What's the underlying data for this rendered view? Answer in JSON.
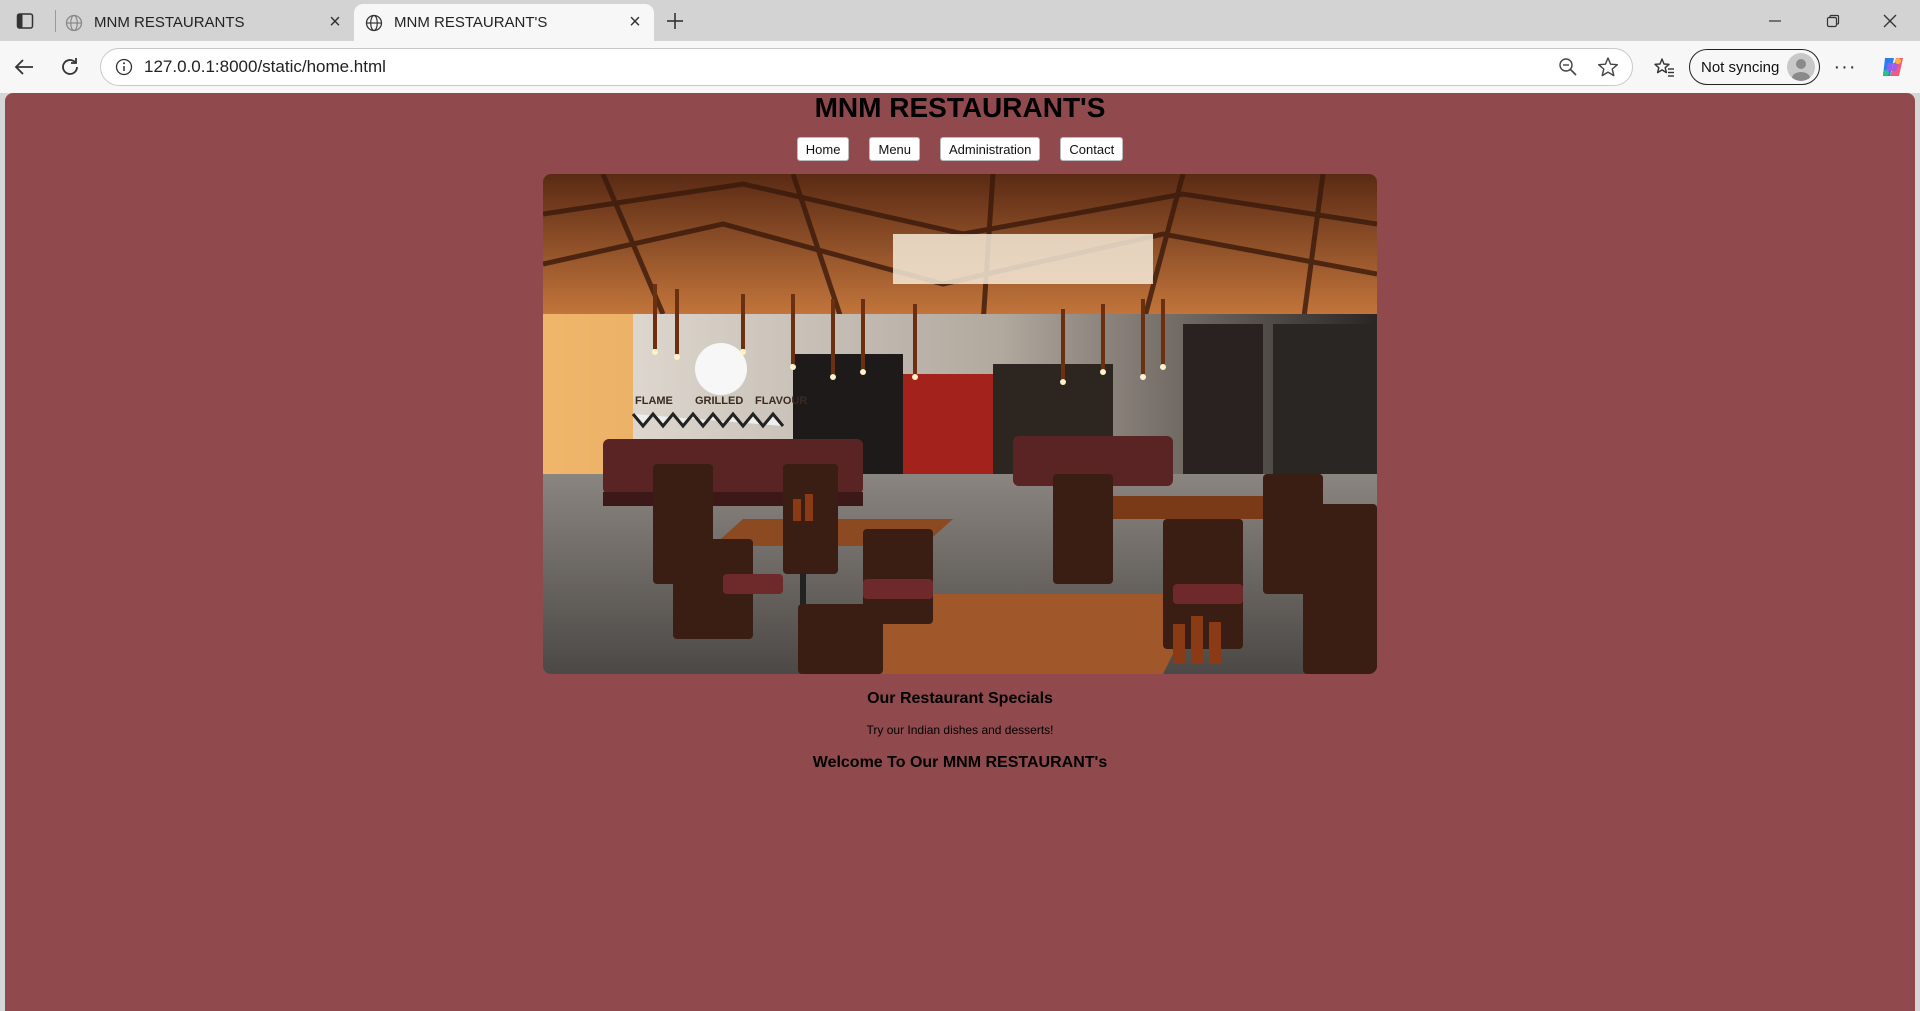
{
  "browser": {
    "tabs": [
      {
        "title": "MNM RESTAURANTS",
        "active": false
      },
      {
        "title": "MNM RESTAURANT'S",
        "active": true
      }
    ],
    "new_tab_icon": "plus-icon",
    "address": "127.0.0.1:8000/static/home.html",
    "profile_label": "Not syncing",
    "more_label": "···",
    "accent_color": "#904a4d"
  },
  "page": {
    "title": "MNM RESTAURANT'S",
    "nav": [
      "Home",
      "Menu",
      "Administration",
      "Contact"
    ],
    "hero_image": "restaurant-dining-room-photo",
    "hero_sign": {
      "word1": "FLAME",
      "word2": "GRILLED",
      "word3": "FLAVOUR"
    },
    "specials_heading": "Our Restaurant Specials",
    "specials_text": "Try our Indian dishes and desserts!",
    "welcome": "Welcome To Our MNM RESTAURANT's",
    "background_color": "#904a4d"
  }
}
